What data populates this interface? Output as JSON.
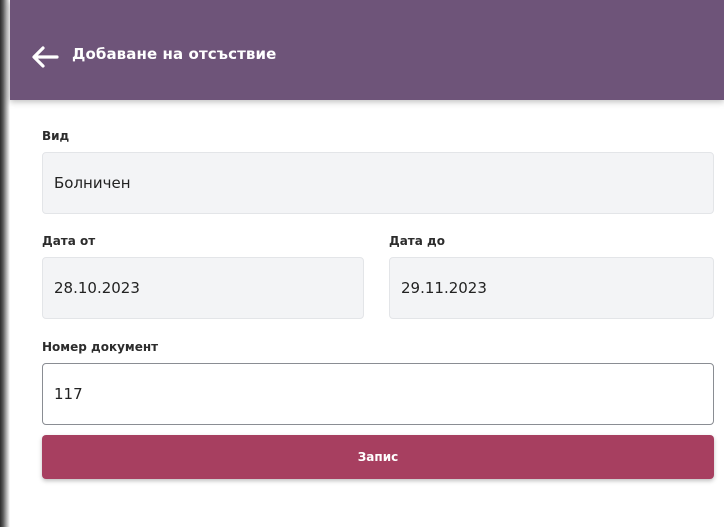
{
  "header": {
    "title": "Добаване на отсъствие",
    "background_color": "#6e5479",
    "back_icon": "arrow-left-icon"
  },
  "form": {
    "type": {
      "label": "Вид",
      "value": "Болничен"
    },
    "date_from": {
      "label": "Дата от",
      "value": "28.10.2023"
    },
    "date_to": {
      "label": "Дата до",
      "value": "29.11.2023"
    },
    "document_number": {
      "label": "Номер документ",
      "value": "117"
    }
  },
  "submit": {
    "label": "Запис",
    "color": "#a73f60"
  }
}
